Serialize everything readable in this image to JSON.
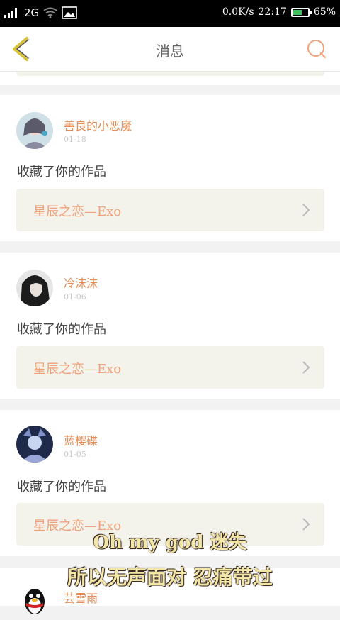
{
  "status_bar": {
    "network": "2G",
    "speed": "0.0K/s",
    "time": "22:17",
    "battery": "65%",
    "battery_level": 0.65,
    "icons": [
      "signal-icon",
      "wifi-icon",
      "gallery-icon",
      "battery-icon"
    ]
  },
  "nav": {
    "title": "消息",
    "back_icon": "back-chevron-icon",
    "search_icon": "search-icon",
    "accent_color": "#e38c55",
    "back_color": "#d8c23a"
  },
  "messages": [
    {
      "user": "善良的小恶魔",
      "date": "01-18",
      "action": "收藏了你的作品",
      "work": "星辰之恋—Exo"
    },
    {
      "user": "冷沫沫",
      "date": "01-06",
      "action": "收藏了你的作品",
      "work": "星辰之恋—Exo"
    },
    {
      "user": "蓝樱碟",
      "date": "01-05",
      "action": "收藏了你的作品",
      "work": "星辰之恋—Exo"
    },
    {
      "user": "芸雪雨"
    }
  ],
  "overlay": {
    "line1": "Oh my god 迷失",
    "line2": "所以无声面对 忍痛带过"
  }
}
